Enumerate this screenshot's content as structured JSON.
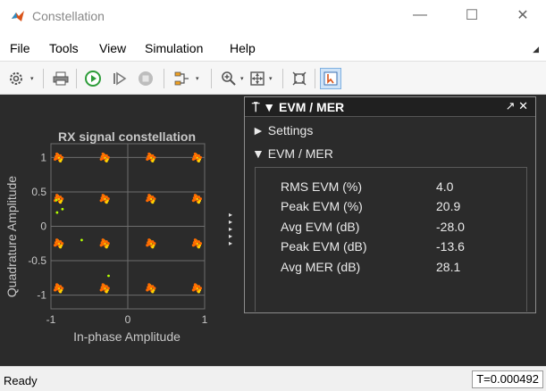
{
  "window": {
    "title": "Constellation",
    "minimize_glyph": "—",
    "maximize_glyph": "☐",
    "close_glyph": "✕"
  },
  "menu": {
    "items": [
      "File",
      "Tools",
      "View",
      "Simulation",
      "Help"
    ],
    "overflow_glyph": "◢"
  },
  "toolbar": {
    "icons": [
      "settings-icon",
      "print-icon",
      "run-icon",
      "step-forward-icon",
      "stop-icon",
      "signal-select-icon",
      "zoom-in-icon",
      "fit-to-view-icon",
      "autoscale-icon",
      "data-cursor-icon"
    ],
    "dropdown_glyph": "▾"
  },
  "chart": {
    "title": "RX signal constellation",
    "xlabel": "In-phase Amplitude",
    "ylabel": "Quadrature Amplitude",
    "xticks": [
      "-1",
      "0",
      "1"
    ],
    "yticks": [
      "1",
      "0.5",
      "0",
      "-0.5",
      "-1"
    ],
    "colors": {
      "background": "#2b2b2b",
      "grid": "#6e6e6e",
      "axes_text": "#c8c8c8",
      "points": "#ff6a00",
      "points_light": "#ffd400",
      "outliers": "#b4ff00"
    }
  },
  "chart_data": {
    "type": "scatter",
    "title": "RX signal constellation",
    "xlabel": "In-phase Amplitude",
    "ylabel": "Quadrature Amplitude",
    "xlim": [
      -1,
      1
    ],
    "ylim": [
      -1.2,
      1.2
    ],
    "grid": true,
    "series": [
      {
        "points": [
          [
            -0.9,
            1.0
          ],
          [
            -0.3,
            1.0
          ],
          [
            0.3,
            1.0
          ],
          [
            0.9,
            1.0
          ],
          [
            -0.9,
            0.4
          ],
          [
            -0.3,
            0.4
          ],
          [
            0.3,
            0.4
          ],
          [
            0.9,
            0.4
          ],
          [
            -0.9,
            -0.25
          ],
          [
            -0.3,
            -0.25
          ],
          [
            0.3,
            -0.25
          ],
          [
            0.9,
            -0.25
          ],
          [
            -0.9,
            -0.9
          ],
          [
            -0.3,
            -0.9
          ],
          [
            0.3,
            -0.9
          ],
          [
            0.9,
            -0.9
          ]
        ]
      },
      {
        "points": [
          [
            -0.85,
            0.25
          ],
          [
            -0.92,
            0.2
          ],
          [
            -0.6,
            -0.2
          ],
          [
            -0.25,
            -0.72
          ],
          [
            -0.93,
            0.38
          ]
        ]
      }
    ]
  },
  "panel": {
    "header_title": "⍑ ▼ EVM / MER",
    "header_controls": "↗ ✕",
    "settings_label": "► Settings",
    "section_label": "▼ EVM / MER",
    "metrics": [
      {
        "label": "RMS EVM (%)",
        "value": "4.0"
      },
      {
        "label": "Peak EVM (%)",
        "value": "20.9"
      },
      {
        "label": "Avg EVM (dB)",
        "value": "-28.0"
      },
      {
        "label": "Peak EVM (dB)",
        "value": "-13.6"
      },
      {
        "label": "Avg MER (dB)",
        "value": "28.1"
      }
    ]
  },
  "status": {
    "left": "Ready",
    "right": "T=0.000492"
  }
}
